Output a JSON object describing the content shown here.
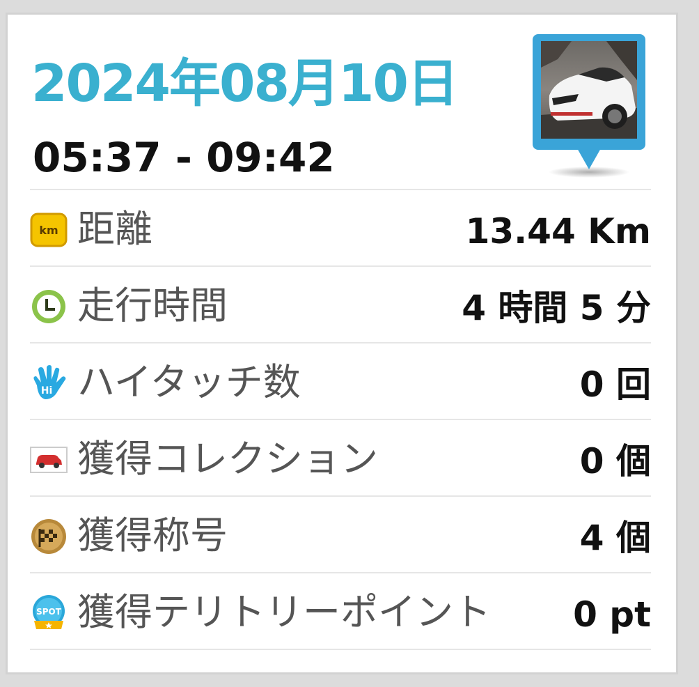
{
  "header": {
    "date": "2024年08月10日",
    "time_range": "05:37 - 09:42"
  },
  "stats": [
    {
      "icon": "km-icon",
      "label": "距離",
      "value": "13.44 Km"
    },
    {
      "icon": "clock-icon",
      "label": "走行時間",
      "value": "4 時間 5 分"
    },
    {
      "icon": "hand-icon",
      "label": "ハイタッチ数",
      "value": "0 回"
    },
    {
      "icon": "car-collection-icon",
      "label": "獲得コレクション",
      "value": "0 個"
    },
    {
      "icon": "checkered-medal-icon",
      "label": "獲得称号",
      "value": "4 個"
    },
    {
      "icon": "spot-badge-icon",
      "label": "獲得テリトリーポイント",
      "value": "0 pt"
    }
  ],
  "icon_text": {
    "km": "km",
    "spot": "SPOT",
    "hi": "Hi"
  },
  "colors": {
    "accent": "#3ab0cf",
    "text": "#111111",
    "label": "#555555",
    "divider": "#e6e6e6"
  }
}
